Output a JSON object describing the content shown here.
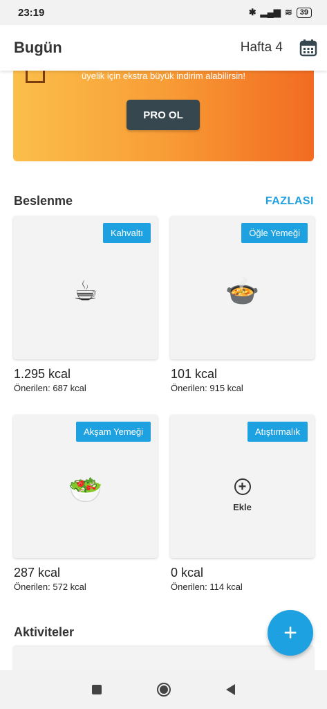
{
  "status_bar": {
    "time": "23:19",
    "battery": "39"
  },
  "app_bar": {
    "title": "Bugün",
    "week_label": "Hafta 4",
    "calendar_icon": "calendar-icon"
  },
  "promo": {
    "text": "üyelik için ekstra büyük indirim alabilirsin!",
    "button_label": "PRO OL"
  },
  "nutrition": {
    "title": "Beslenme",
    "more_label": "FAZLASI",
    "meals": [
      {
        "tag": "Kahvaltı",
        "emoji": "☕",
        "kcal": "1.295 kcal",
        "suggested": "Önerilen: 687 kcal"
      },
      {
        "tag": "Öğle Yemeği",
        "emoji": "🍲",
        "kcal": "101 kcal",
        "suggested": "Önerilen: 915 kcal"
      },
      {
        "tag": "Akşam Yemeği",
        "emoji": "🥗",
        "kcal": "287 kcal",
        "suggested": "Önerilen: 572 kcal"
      },
      {
        "tag": "Atıştırmalık",
        "add_label": "Ekle",
        "kcal": "0 kcal",
        "suggested": "Önerilen: 114 kcal"
      }
    ]
  },
  "activities": {
    "title": "Aktiviteler"
  },
  "fab": {
    "label": "+"
  },
  "colors": {
    "accent": "#1da1e0",
    "pro_button": "#37474f"
  }
}
